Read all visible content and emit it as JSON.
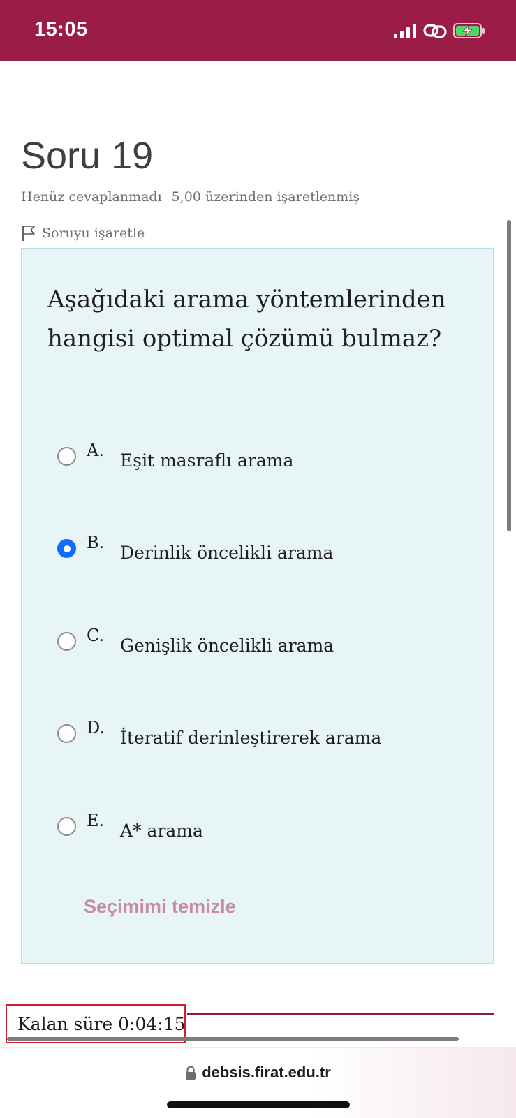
{
  "status_bar": {
    "time": "15:05",
    "icons": [
      "signal-icon",
      "link-icon",
      "battery-charging-icon"
    ]
  },
  "question": {
    "title": "Soru 19",
    "state": "Henüz cevaplanmadı",
    "grade": "5,00 üzerinden işaretlenmiş",
    "flag_label": "Soruyu işaretle",
    "text": "Aşağıdaki arama yöntemlerinden hangisi optimal çözümü bulmaz?",
    "answers": [
      {
        "letter": "A.",
        "text": "Eşit masraflı arama",
        "selected": false
      },
      {
        "letter": "B.",
        "text": "Derinlik öncelikli arama",
        "selected": true
      },
      {
        "letter": "C.",
        "text": "Genişlik öncelikli arama",
        "selected": false
      },
      {
        "letter": "D.",
        "text": "İteratif derinleştirerek arama",
        "selected": false
      },
      {
        "letter": "E.",
        "text": "A* arama",
        "selected": false
      }
    ],
    "clear_choice": "Seçimimi temizle"
  },
  "timer": {
    "text": "Kalan süre 0:04:15"
  },
  "browser": {
    "url": "debsis.firat.edu.tr"
  },
  "colors": {
    "brand": "#9b1d47",
    "question_bg": "#e7f5f6",
    "radio_selected": "#0f6cff",
    "clear_link": "#c88aa6"
  }
}
